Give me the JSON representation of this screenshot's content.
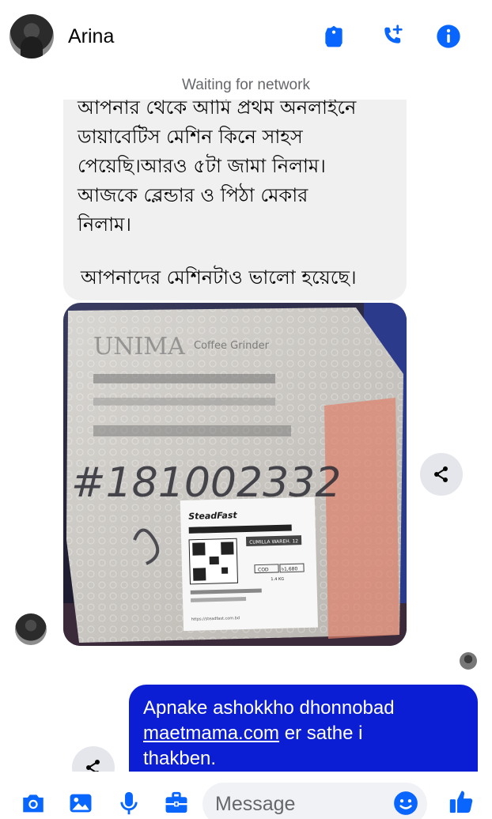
{
  "header": {
    "contact_name": "Arina",
    "icons": [
      "tag-icon",
      "add-call-icon",
      "info-icon"
    ]
  },
  "status": {
    "network": "Waiting for network"
  },
  "messages": {
    "incoming_text": {
      "lines": [
        "আপনার থেকে আমি প্রথম অনলাইনে",
        "ডায়াবেটিস মেশিন কিনে সাহস",
        "পেয়েছি।আরও ৫টা জামা নিলাম।",
        "আজকে ব্লেন্ডার ও পিঠা মেকার",
        "নিলাম।",
        "আপনাদের মেশিনটাও ভালো হয়েছে।"
      ]
    },
    "incoming_photo": {
      "handwritten": "#181002332",
      "package_label": {
        "brand": "SteadFast",
        "area": "CUMILLA WAREH. 12",
        "weight": "1.4 KG",
        "cod": "COD",
        "amount": "৳1,680",
        "url": "https://steadfast.com.bd"
      },
      "box_brand": "UNIMA",
      "box_product": "Coffee Grinder"
    },
    "outgoing_text": {
      "line1": "Apnake ashokkho dhonnobad",
      "link": "maetmama.com",
      "line2_rest": " er sathe i",
      "line3": "thakben."
    }
  },
  "composer": {
    "placeholder": "Message",
    "icons": [
      "camera-icon",
      "gallery-icon",
      "microphone-icon",
      "briefcase-icon",
      "emoji-icon",
      "thumbs-up-icon"
    ]
  },
  "colors": {
    "accent": "#0866ff",
    "outgoing_bubble": "#0c1ed3",
    "incoming_bubble": "#f0f0f0",
    "muted_text": "#65676b"
  }
}
